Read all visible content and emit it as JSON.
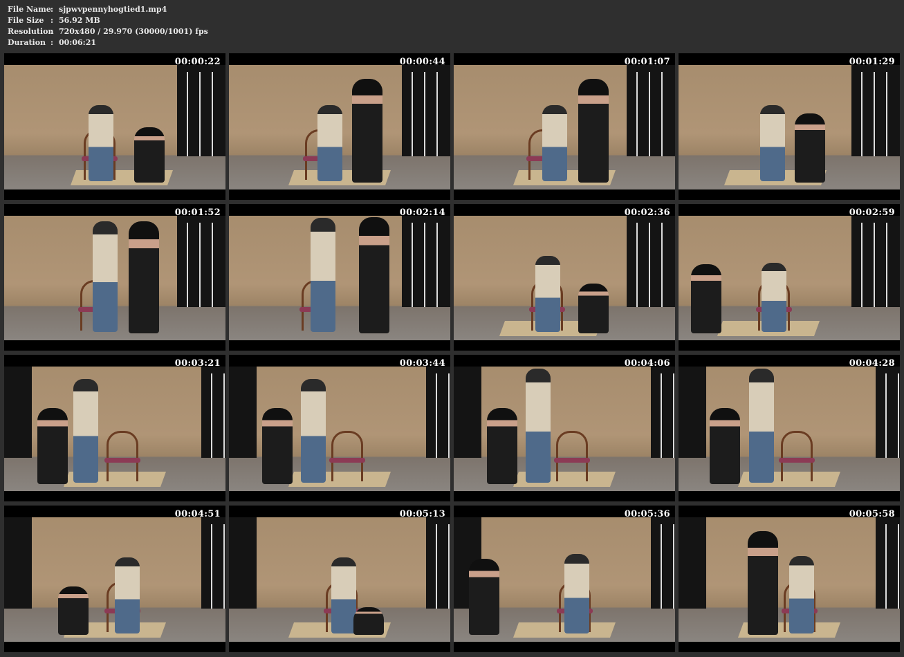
{
  "info": [
    {
      "label": "File Name",
      "value": "sjpwvpennyhogtied1.mp4"
    },
    {
      "label": "File Size",
      "value": "56.92 MB"
    },
    {
      "label": "Resolution",
      "value": "720x480 / 29.970 (30000/1001) fps"
    },
    {
      "label": "Duration",
      "value": "00:06:21"
    }
  ],
  "thumbnails": [
    {
      "time": "00:00:22"
    },
    {
      "time": "00:00:44"
    },
    {
      "time": "00:01:07"
    },
    {
      "time": "00:01:29"
    },
    {
      "time": "00:01:52"
    },
    {
      "time": "00:02:14"
    },
    {
      "time": "00:02:36"
    },
    {
      "time": "00:02:59"
    },
    {
      "time": "00:03:21"
    },
    {
      "time": "00:03:44"
    },
    {
      "time": "00:04:06"
    },
    {
      "time": "00:04:28"
    },
    {
      "time": "00:04:51"
    },
    {
      "time": "00:05:13"
    },
    {
      "time": "00:05:36"
    },
    {
      "time": "00:05:58"
    }
  ]
}
